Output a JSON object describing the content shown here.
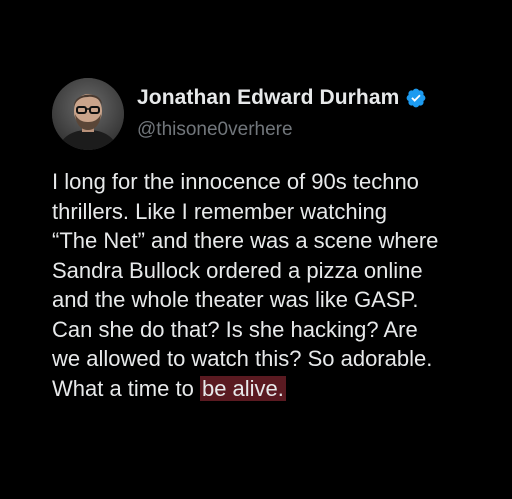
{
  "tweet": {
    "author": {
      "display_name": "Jonathan Edward Durham",
      "handle": "@thisone0verhere",
      "verified": true,
      "avatar_icon": "profile-photo"
    },
    "text_lines": [
      "I long for the innocence of 90s techno",
      "thrillers. Like I remember watching",
      "“The Net” and there was a scene where",
      "Sandra Bullock ordered a pizza online",
      "and the whole theater was like GASP.",
      "Can she do that? Is she hacking? Are",
      "we allowed to watch this? So adorable."
    ],
    "last_line_plain": "What a time to ",
    "last_line_highlighted": "be alive."
  },
  "colors": {
    "background": "#000000",
    "text": "#e7e9ea",
    "handle": "#71767b",
    "verified": "#1d9bf0",
    "highlight": "#5a1a21"
  }
}
